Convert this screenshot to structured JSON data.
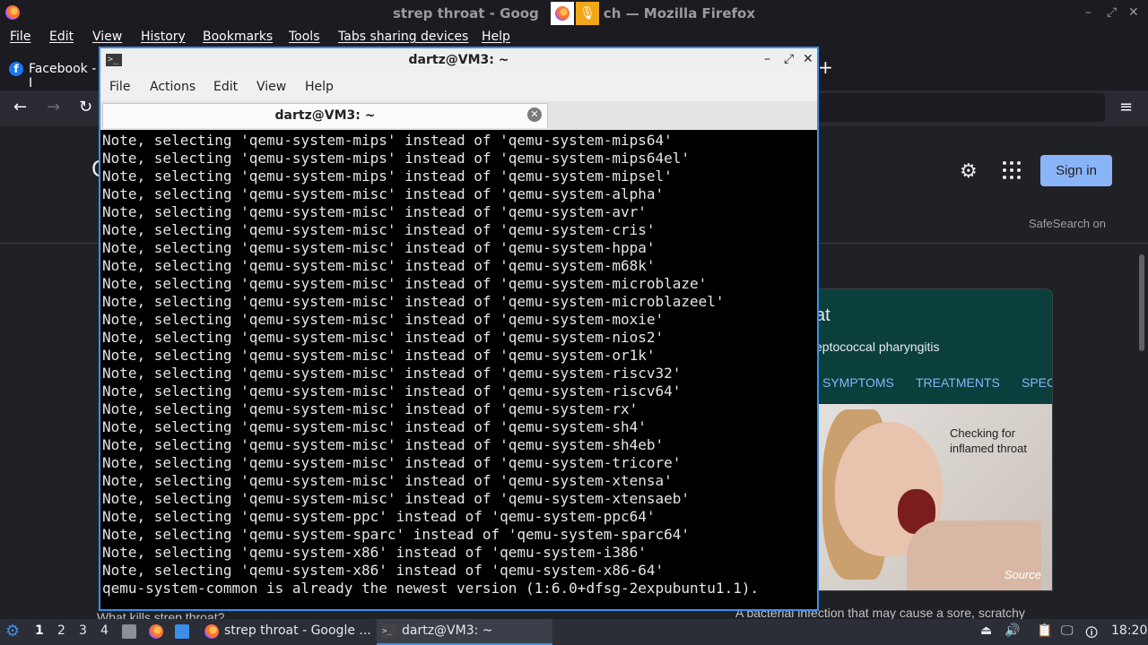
{
  "firefox": {
    "window_title": "strep throat - Google Search — Mozilla Firefox",
    "title_visible_left": "strep throat - Goog",
    "title_visible_right": "ch — Mozilla Firefox",
    "menu": [
      "File",
      "Edit",
      "View",
      "History",
      "Bookmarks",
      "Tools",
      "Tabs sharing devices",
      "Help"
    ],
    "tab_label": "Facebook - I",
    "new_tab": "+",
    "nav": {
      "back": "←",
      "forward": "→",
      "reload": "↻",
      "menu": "≡"
    }
  },
  "google": {
    "signin_label": "Sign in",
    "safesearch": "SafeSearch on",
    "left_fragment": "G",
    "knowledge_panel": {
      "title_fragment": "at",
      "subtitle_fragment": "eptococcal pharyngitis",
      "tabs": [
        "SYMPTOMS",
        "TREATMENTS",
        "SPEC"
      ],
      "image_caption_line1": "Checking for",
      "image_caption_line2": "inflamed throat",
      "image_source": "Source"
    },
    "snippet_fragment": "A bacterial infection that may cause a sore, scratchy",
    "left_snippet_fragment": "What kills strep throat?"
  },
  "terminal": {
    "window_title": "dartz@VM3: ~",
    "menu": [
      "File",
      "Actions",
      "Edit",
      "View",
      "Help"
    ],
    "tab_title": "dartz@VM3: ~",
    "lines": [
      "Note, selecting 'qemu-system-mips' instead of 'qemu-system-mips64'",
      "Note, selecting 'qemu-system-mips' instead of 'qemu-system-mips64el'",
      "Note, selecting 'qemu-system-mips' instead of 'qemu-system-mipsel'",
      "Note, selecting 'qemu-system-misc' instead of 'qemu-system-alpha'",
      "Note, selecting 'qemu-system-misc' instead of 'qemu-system-avr'",
      "Note, selecting 'qemu-system-misc' instead of 'qemu-system-cris'",
      "Note, selecting 'qemu-system-misc' instead of 'qemu-system-hppa'",
      "Note, selecting 'qemu-system-misc' instead of 'qemu-system-m68k'",
      "Note, selecting 'qemu-system-misc' instead of 'qemu-system-microblaze'",
      "Note, selecting 'qemu-system-misc' instead of 'qemu-system-microblazeel'",
      "Note, selecting 'qemu-system-misc' instead of 'qemu-system-moxie'",
      "Note, selecting 'qemu-system-misc' instead of 'qemu-system-nios2'",
      "Note, selecting 'qemu-system-misc' instead of 'qemu-system-or1k'",
      "Note, selecting 'qemu-system-misc' instead of 'qemu-system-riscv32'",
      "Note, selecting 'qemu-system-misc' instead of 'qemu-system-riscv64'",
      "Note, selecting 'qemu-system-misc' instead of 'qemu-system-rx'",
      "Note, selecting 'qemu-system-misc' instead of 'qemu-system-sh4'",
      "Note, selecting 'qemu-system-misc' instead of 'qemu-system-sh4eb'",
      "Note, selecting 'qemu-system-misc' instead of 'qemu-system-tricore'",
      "Note, selecting 'qemu-system-misc' instead of 'qemu-system-xtensa'",
      "Note, selecting 'qemu-system-misc' instead of 'qemu-system-xtensaeb'",
      "Note, selecting 'qemu-system-ppc' instead of 'qemu-system-ppc64'",
      "Note, selecting 'qemu-system-sparc' instead of 'qemu-system-sparc64'",
      "Note, selecting 'qemu-system-x86' instead of 'qemu-system-i386'",
      "Note, selecting 'qemu-system-x86' instead of 'qemu-system-x86-64'",
      "qemu-system-common is already the newest version (1:6.0+dfsg-2expubuntu1.1)."
    ]
  },
  "taskbar": {
    "workspaces": [
      "1",
      "2",
      "3",
      "4"
    ],
    "active_workspace": "1",
    "tasks": [
      {
        "label": "strep throat - Google ...",
        "icon": "firefox-icon"
      },
      {
        "label": "dartz@VM3: ~",
        "icon": "terminal-icon"
      }
    ],
    "clock": "18:20"
  },
  "colors": {
    "accent": "#3d8ee6",
    "signin": "#8ab4f8",
    "panel": "#0b3f3c"
  }
}
